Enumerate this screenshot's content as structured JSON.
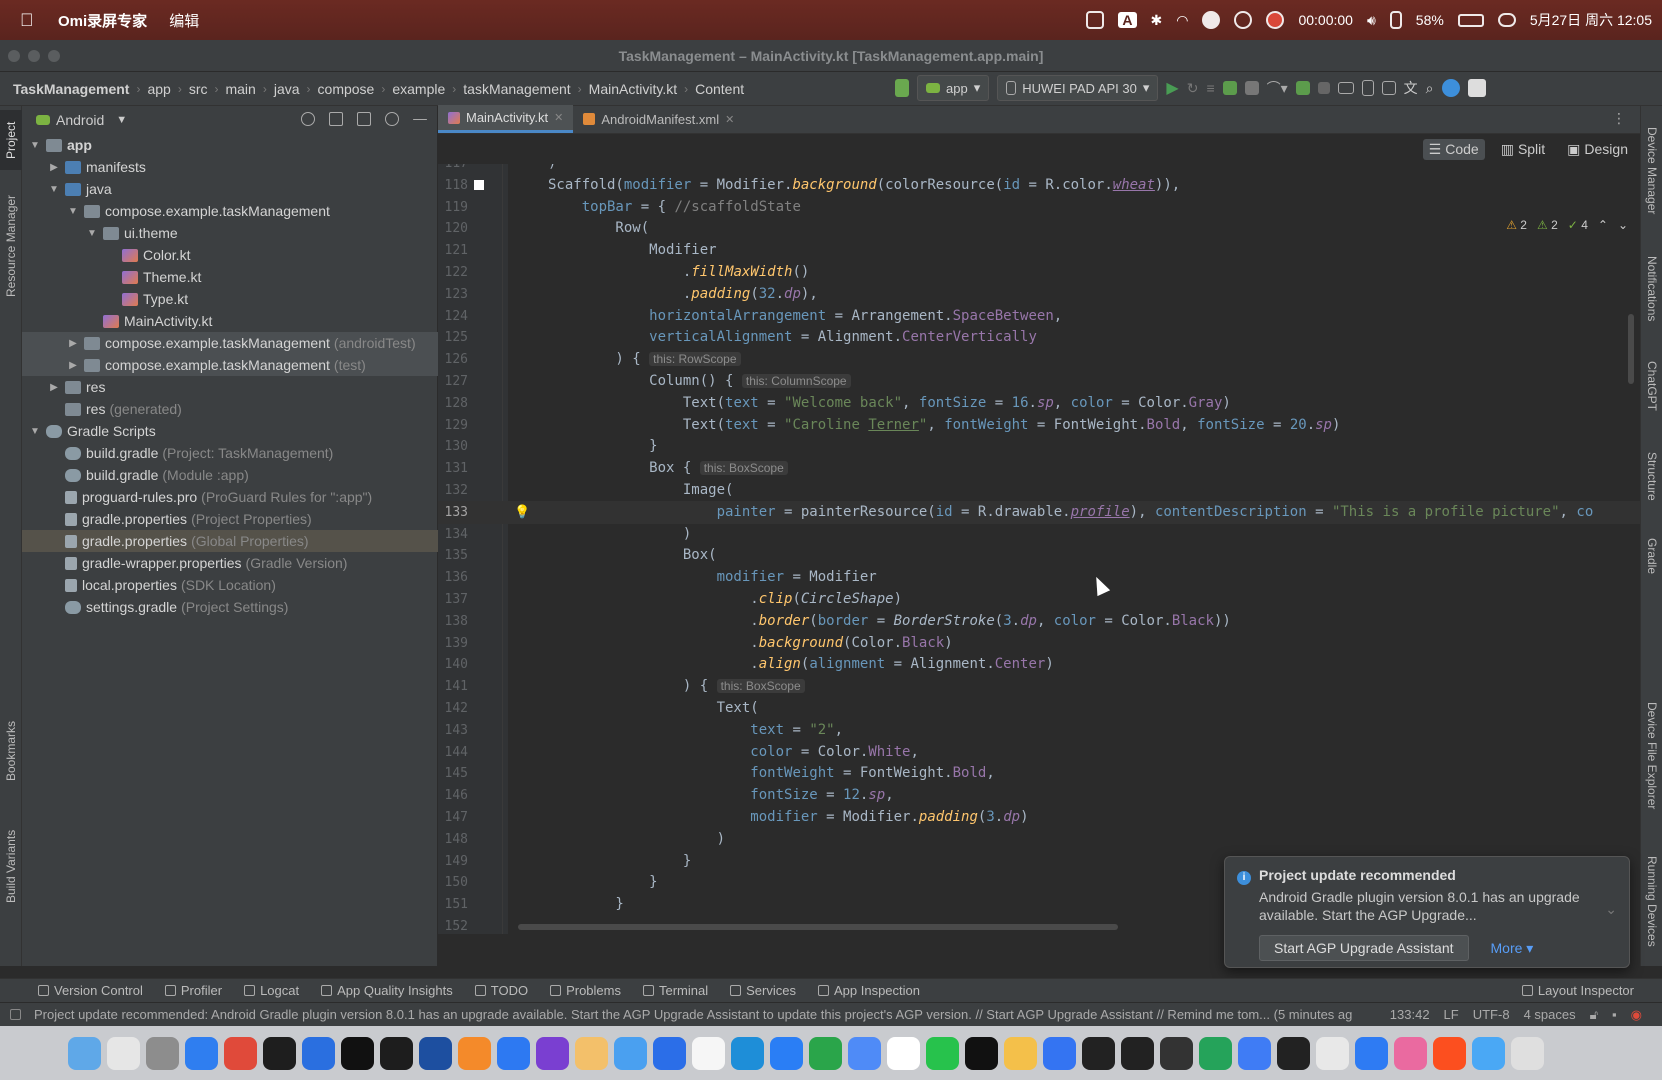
{
  "menubar": {
    "app_name": "Omi录屏专家",
    "menu_edit": "编辑",
    "record_time": "00:00:00",
    "battery": "58%",
    "date_time": "5月27日 周六 12:05",
    "input": "A"
  },
  "window_title": "TaskManagement – MainActivity.kt [TaskManagement.app.main]",
  "breadcrumbs": [
    "TaskManagement",
    "app",
    "src",
    "main",
    "java",
    "compose",
    "example",
    "taskManagement",
    "MainActivity.kt",
    "Content"
  ],
  "toolbar": {
    "run_config": "app",
    "device": "HUWEI PAD API 30"
  },
  "project": {
    "view": "Android",
    "tree": [
      {
        "label": "app",
        "hint": "",
        "depth": 0,
        "arrow": "down",
        "icon": "folder",
        "bold": true
      },
      {
        "label": "manifests",
        "hint": "",
        "depth": 1,
        "arrow": "right",
        "icon": "bluefolder"
      },
      {
        "label": "java",
        "hint": "",
        "depth": 1,
        "arrow": "down",
        "icon": "bluefolder"
      },
      {
        "label": "compose.example.taskManagement",
        "hint": "",
        "depth": 2,
        "arrow": "down",
        "icon": "folder"
      },
      {
        "label": "ui.theme",
        "hint": "",
        "depth": 3,
        "arrow": "down",
        "icon": "folder"
      },
      {
        "label": "Color.kt",
        "hint": "",
        "depth": 4,
        "arrow": "",
        "icon": "kt"
      },
      {
        "label": "Theme.kt",
        "hint": "",
        "depth": 4,
        "arrow": "",
        "icon": "kt"
      },
      {
        "label": "Type.kt",
        "hint": "",
        "depth": 4,
        "arrow": "",
        "icon": "kt"
      },
      {
        "label": "MainActivity.kt",
        "hint": "",
        "depth": 3,
        "arrow": "",
        "icon": "kt"
      },
      {
        "label": "compose.example.taskManagement",
        "hint": "(androidTest)",
        "depth": 2,
        "arrow": "right",
        "icon": "folder",
        "sel": true
      },
      {
        "label": "compose.example.taskManagement",
        "hint": "(test)",
        "depth": 2,
        "arrow": "right",
        "icon": "folder",
        "sel": true
      },
      {
        "label": "res",
        "hint": "",
        "depth": 1,
        "arrow": "right",
        "icon": "folder"
      },
      {
        "label": "res",
        "hint": "(generated)",
        "depth": 1,
        "arrow": "",
        "icon": "folder"
      },
      {
        "label": "Gradle Scripts",
        "hint": "",
        "depth": 0,
        "arrow": "down",
        "icon": "gradle"
      },
      {
        "label": "build.gradle",
        "hint": "(Project: TaskManagement)",
        "depth": 1,
        "arrow": "",
        "icon": "gradle"
      },
      {
        "label": "build.gradle",
        "hint": "(Module :app)",
        "depth": 1,
        "arrow": "",
        "icon": "gradle"
      },
      {
        "label": "proguard-rules.pro",
        "hint": "(ProGuard Rules for \":app\")",
        "depth": 1,
        "arrow": "",
        "icon": "file"
      },
      {
        "label": "gradle.properties",
        "hint": "(Project Properties)",
        "depth": 1,
        "arrow": "",
        "icon": "file"
      },
      {
        "label": "gradle.properties",
        "hint": "(Global Properties)",
        "depth": 1,
        "arrow": "",
        "icon": "file",
        "sel2": true
      },
      {
        "label": "gradle-wrapper.properties",
        "hint": "(Gradle Version)",
        "depth": 1,
        "arrow": "",
        "icon": "file"
      },
      {
        "label": "local.properties",
        "hint": "(SDK Location)",
        "depth": 1,
        "arrow": "",
        "icon": "file"
      },
      {
        "label": "settings.gradle",
        "hint": "(Project Settings)",
        "depth": 1,
        "arrow": "",
        "icon": "gradle"
      }
    ]
  },
  "left_tabs": [
    "Project",
    "Resource Manager",
    "Bookmarks",
    "Build Variants"
  ],
  "right_tabs": [
    "Device Manager",
    "Notifications",
    "ChatGPT",
    "Structure",
    "Gradle",
    "Device File Explorer",
    "Running Devices"
  ],
  "editor": {
    "tabs": [
      "MainActivity.kt",
      "AndroidManifest.xml"
    ],
    "view_modes": [
      "Code",
      "Split",
      "Design"
    ],
    "inspections": {
      "warn": "2",
      "weak": "2",
      "ok": "4"
    },
    "current_line": 133
  },
  "code": [
    {
      "n": 117,
      "h": ")"
    },
    {
      "n": 118,
      "h": "<span class='ty'>Scaffold(</span><span class='pm'>modifier</span> = Modifier.<span class='fn'>background</span>(colorResource(<span class='pm'>id</span> = R.color.<span class='pr it ul'>wheat</span>)),"
    },
    {
      "n": 119,
      "h": "    <span class='pm'>topBar</span> = { <span style='color:#808080'>//scaffoldState</span>"
    },
    {
      "n": 120,
      "h": "        Row("
    },
    {
      "n": 121,
      "h": "            Modifier"
    },
    {
      "n": 122,
      "h": "                .<span class='fn'>fillMaxWidth</span>()"
    },
    {
      "n": 123,
      "h": "                .<span class='fn'>padding</span>(<span class='num'>32</span>.<span class='pr it'>dp</span>),"
    },
    {
      "n": 124,
      "h": "            <span class='pm'>horizontalArrangement</span> = Arrangement.<span class='pr'>SpaceBetween</span>,"
    },
    {
      "n": 125,
      "h": "            <span class='pm'>verticalAlignment</span> = Alignment.<span class='pr'>CenterVertically</span>"
    },
    {
      "n": 126,
      "h": "        ) { <span class='hint'>this: RowScope</span>"
    },
    {
      "n": 127,
      "h": "            Column() { <span class='hint'>this: ColumnScope</span>"
    },
    {
      "n": 128,
      "h": "                Text(<span class='pm'>text</span> = <span class='st'>\"Welcome back\"</span>, <span class='pm'>fontSize</span> = <span class='num'>16</span>.<span class='pr it'>sp</span>, <span class='pm'>color</span> = Color.<span class='pr'>Gray</span>)"
    },
    {
      "n": 129,
      "h": "                Text(<span class='pm'>text</span> = <span class='st'>\"Caroline <span class='ul'>Terner</span>\"</span>, <span class='pm'>fontWeight</span> = FontWeight.<span class='pr'>Bold</span>, <span class='pm'>fontSize</span> = <span class='num'>20</span>.<span class='pr it'>sp</span>)"
    },
    {
      "n": 130,
      "h": "            }"
    },
    {
      "n": 131,
      "h": "            Box { <span class='hint'>this: BoxScope</span>"
    },
    {
      "n": 132,
      "h": "                Image("
    },
    {
      "n": 133,
      "h": "                    <span class='pm'>painter</span> = painterResource(<span class='pm'>id</span> = R.drawable.<span class='pr it ul'>profile</span>), <span class='pm'>contentDescription</span> = <span class='st'>\"This is a profile picture\"</span>, <span class='pm'>co</span>"
    },
    {
      "n": 134,
      "h": "                )"
    },
    {
      "n": 135,
      "h": "                Box("
    },
    {
      "n": 136,
      "h": "                    <span class='pm'>modifier</span> = Modifier"
    },
    {
      "n": 137,
      "h": "                        .<span class='fn'>clip</span>(<span class='it'>CircleShape</span>)"
    },
    {
      "n": 138,
      "h": "                        .<span class='fn'>border</span>(<span class='pm'>border</span> = <span class='it'>BorderStroke</span>(<span class='num'>3</span>.<span class='pr it'>dp</span>, <span class='pm'>color</span> = Color.<span class='pr'>Black</span>))"
    },
    {
      "n": 139,
      "h": "                        .<span class='fn'>background</span>(Color.<span class='pr'>Black</span>)"
    },
    {
      "n": 140,
      "h": "                        .<span class='fn'>align</span>(<span class='pm'>alignment</span> = Alignment.<span class='pr'>Center</span>)"
    },
    {
      "n": 141,
      "h": "                ) { <span class='hint'>this: BoxScope</span>"
    },
    {
      "n": 142,
      "h": "                    Text("
    },
    {
      "n": 143,
      "h": "                        <span class='pm'>text</span> = <span class='st'>\"2\"</span>,"
    },
    {
      "n": 144,
      "h": "                        <span class='pm'>color</span> = Color.<span class='pr'>White</span>,"
    },
    {
      "n": 145,
      "h": "                        <span class='pm'>fontWeight</span> = FontWeight.<span class='pr'>Bold</span>,"
    },
    {
      "n": 146,
      "h": "                        <span class='pm'>fontSize</span> = <span class='num'>12</span>.<span class='pr it'>sp</span>,"
    },
    {
      "n": 147,
      "h": "                        <span class='pm'>modifier</span> = Modifier.<span class='fn'>padding</span>(<span class='num'>3</span>.<span class='pr it'>dp</span>)"
    },
    {
      "n": 148,
      "h": "                    )"
    },
    {
      "n": 149,
      "h": "                }"
    },
    {
      "n": 150,
      "h": "            }"
    },
    {
      "n": 151,
      "h": "        }"
    },
    {
      "n": 152,
      "h": ""
    }
  ],
  "notification": {
    "title": "Project update recommended",
    "body": "Android Gradle plugin version 8.0.1 has an upgrade available. Start the AGP Upgrade...",
    "button": "Start AGP Upgrade Assistant",
    "more": "More ▾"
  },
  "tool_windows": [
    "Version Control",
    "Profiler",
    "Logcat",
    "App Quality Insights",
    "TODO",
    "Problems",
    "Terminal",
    "Services",
    "App Inspection"
  ],
  "layout_inspector": "Layout Inspector",
  "status": {
    "message": "Project update recommended: Android Gradle plugin version 8.0.1 has an upgrade available. Start the AGP Upgrade Assistant to update this project's AGP version. // Start AGP Upgrade Assistant // Remind me tom... (5 minutes ag",
    "position": "133:42",
    "line_sep": "LF",
    "encoding": "UTF-8",
    "indent": "4 spaces"
  },
  "dock_colors": [
    "#5fa8e8",
    "#e6e6e6",
    "#8d8d8d",
    "#2f7ef0",
    "#e04a3a",
    "#1e1e1e",
    "#2a6fe0",
    "#111111",
    "#1d1d1d",
    "#1d4fa0",
    "#f48a2a",
    "#2d79f2",
    "#7a3fd1",
    "#f3c06a",
    "#4aa0f0",
    "#2b6ee8",
    "#f6f6f6",
    "#1e8ed8",
    "#2a7ef5",
    "#2aa54a",
    "#4f8bf7",
    "#ffffff",
    "#27c24c",
    "#111111",
    "#f4c04a",
    "#3474f2",
    "#222222",
    "#222222",
    "#333333",
    "#25a35a",
    "#3f7cf5",
    "#222222",
    "#e8e8e8",
    "#2e7bf3",
    "#ea6aa0",
    "#fc4f1f",
    "#4aa8f5",
    "#dfdfdf"
  ]
}
